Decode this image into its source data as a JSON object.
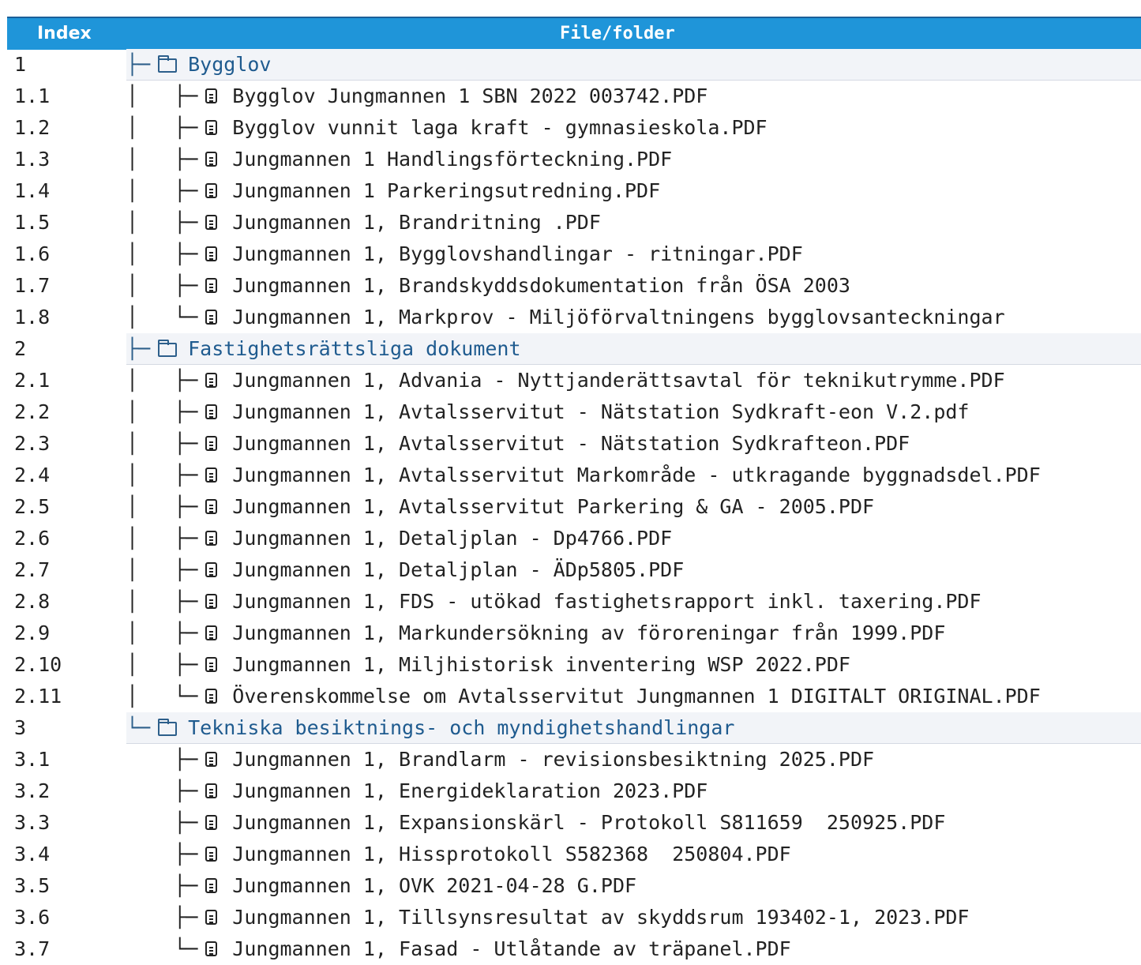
{
  "header": {
    "index_label": "Index",
    "file_label": "File/folder"
  },
  "rows": [
    {
      "index": "1",
      "tree": "├─",
      "type": "folder",
      "name": "Bygglov"
    },
    {
      "index": "1.1",
      "tree": "│   ├─",
      "type": "file",
      "name": "Bygglov Jungmannen 1 SBN 2022 003742.PDF"
    },
    {
      "index": "1.2",
      "tree": "│   ├─",
      "type": "file",
      "name": "Bygglov vunnit laga kraft - gymnasieskola.PDF"
    },
    {
      "index": "1.3",
      "tree": "│   ├─",
      "type": "file",
      "name": "Jungmannen 1 Handlingsförteckning.PDF"
    },
    {
      "index": "1.4",
      "tree": "│   ├─",
      "type": "file",
      "name": "Jungmannen 1 Parkeringsutredning.PDF"
    },
    {
      "index": "1.5",
      "tree": "│   ├─",
      "type": "file",
      "name": "Jungmannen 1, Brandritning .PDF"
    },
    {
      "index": "1.6",
      "tree": "│   ├─",
      "type": "file",
      "name": "Jungmannen 1, Bygglovshandlingar - ritningar.PDF"
    },
    {
      "index": "1.7",
      "tree": "│   ├─",
      "type": "file",
      "name": "Jungmannen 1, Brandskyddsdokumentation från ÖSA 2003"
    },
    {
      "index": "1.8",
      "tree": "│   └─",
      "type": "file",
      "name": "Jungmannen 1, Markprov - Miljöförvaltningens bygglovsanteckningar"
    },
    {
      "index": "2",
      "tree": "├─",
      "type": "folder",
      "name": "Fastighetsrättsliga dokument"
    },
    {
      "index": "2.1",
      "tree": "│   ├─",
      "type": "file",
      "name": "Jungmannen 1, Advania - Nyttjanderättsavtal för teknikutrymme.PDF"
    },
    {
      "index": "2.2",
      "tree": "│   ├─",
      "type": "file",
      "name": "Jungmannen 1, Avtalsservitut - Nätstation Sydkraft-eon V.2.pdf"
    },
    {
      "index": "2.3",
      "tree": "│   ├─",
      "type": "file",
      "name": "Jungmannen 1, Avtalsservitut - Nätstation Sydkrafteon.PDF"
    },
    {
      "index": "2.4",
      "tree": "│   ├─",
      "type": "file",
      "name": "Jungmannen 1, Avtalsservitut Markområde - utkragande byggnadsdel.PDF"
    },
    {
      "index": "2.5",
      "tree": "│   ├─",
      "type": "file",
      "name": "Jungmannen 1, Avtalsservitut Parkering & GA - 2005.PDF"
    },
    {
      "index": "2.6",
      "tree": "│   ├─",
      "type": "file",
      "name": "Jungmannen 1, Detaljplan - Dp4766.PDF"
    },
    {
      "index": "2.7",
      "tree": "│   ├─",
      "type": "file",
      "name": "Jungmannen 1, Detaljplan - ÄDp5805.PDF"
    },
    {
      "index": "2.8",
      "tree": "│   ├─",
      "type": "file",
      "name": "Jungmannen 1, FDS - utökad fastighetsrapport inkl. taxering.PDF"
    },
    {
      "index": "2.9",
      "tree": "│   ├─",
      "type": "file",
      "name": "Jungmannen 1, Markundersökning av föroreningar från 1999.PDF"
    },
    {
      "index": "2.10",
      "tree": "│   ├─",
      "type": "file",
      "name": "Jungmannen 1, Miljhistorisk inventering WSP 2022.PDF"
    },
    {
      "index": "2.11",
      "tree": "│   └─",
      "type": "file",
      "name": "Överenskommelse om Avtalsservitut Jungmannen 1 DIGITALT ORIGINAL.PDF"
    },
    {
      "index": "3",
      "tree": "└─",
      "type": "folder",
      "name": "Tekniska besiktnings- och myndighetshandlingar"
    },
    {
      "index": "3.1",
      "tree": "    ├─",
      "type": "file",
      "name": "Jungmannen 1, Brandlarm - revisionsbesiktning 2025.PDF"
    },
    {
      "index": "3.2",
      "tree": "    ├─",
      "type": "file",
      "name": "Jungmannen 1, Energideklaration 2023.PDF"
    },
    {
      "index": "3.3",
      "tree": "    ├─",
      "type": "file",
      "name": "Jungmannen 1, Expansionskärl - Protokoll S811659  250925.PDF"
    },
    {
      "index": "3.4",
      "tree": "    ├─",
      "type": "file",
      "name": "Jungmannen 1, Hissprotokoll S582368  250804.PDF"
    },
    {
      "index": "3.5",
      "tree": "    ├─",
      "type": "file",
      "name": "Jungmannen 1, OVK 2021-04-28 G.PDF"
    },
    {
      "index": "3.6",
      "tree": "    ├─",
      "type": "file",
      "name": "Jungmannen 1, Tillsynsresultat av skyddsrum 193402-1, 2023.PDF"
    },
    {
      "index": "3.7",
      "tree": "    └─",
      "type": "file",
      "name": "Jungmannen 1, Fasad - Utlåtande av träpanel.PDF"
    }
  ]
}
